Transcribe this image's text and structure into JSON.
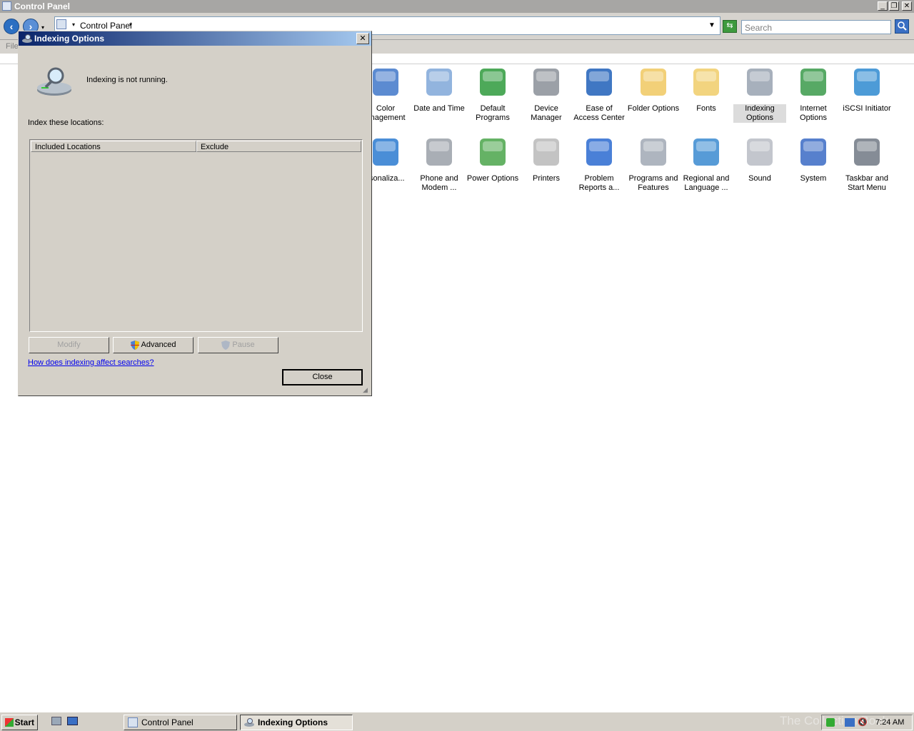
{
  "main_window": {
    "title": "Control Panel",
    "minimize": "_",
    "maximize": "❐",
    "close": "✕"
  },
  "address_bar": {
    "breadcrumb": "Control Panel",
    "search_placeholder": "Search"
  },
  "menu": {
    "file": "File"
  },
  "control_panel_items": [
    {
      "label": "Color\nManagement",
      "visible_text": "Color\nanagement",
      "icon": "color-management-icon"
    },
    {
      "label": "Date and Time",
      "icon": "calendar-clock-icon"
    },
    {
      "label": "Default\nPrograms",
      "icon": "default-programs-icon"
    },
    {
      "label": "Device\nManager",
      "icon": "device-manager-icon"
    },
    {
      "label": "Ease of\nAccess Center",
      "icon": "ease-of-access-icon"
    },
    {
      "label": "Folder Options",
      "icon": "folder-options-icon"
    },
    {
      "label": "Fonts",
      "icon": "fonts-folder-icon"
    },
    {
      "label": "Indexing\nOptions",
      "icon": "indexing-icon",
      "selected": true
    },
    {
      "label": "Internet\nOptions",
      "icon": "internet-options-icon"
    },
    {
      "label": "iSCSI Initiator",
      "icon": "iscsi-icon"
    },
    {
      "label": "rsonaliza...",
      "icon": "personalization-icon"
    },
    {
      "label": "Phone and\nModem ...",
      "icon": "phone-modem-icon"
    },
    {
      "label": "Power Options",
      "icon": "power-options-icon"
    },
    {
      "label": "Printers",
      "icon": "printer-icon"
    },
    {
      "label": "Problem\nReports a...",
      "icon": "problem-reports-icon"
    },
    {
      "label": "Programs and\nFeatures",
      "icon": "programs-features-icon"
    },
    {
      "label": "Regional and\nLanguage ...",
      "icon": "regional-language-icon"
    },
    {
      "label": "Sound",
      "icon": "sound-icon"
    },
    {
      "label": "System",
      "icon": "system-icon"
    },
    {
      "label": "Taskbar and\nStart Menu",
      "icon": "taskbar-start-icon"
    }
  ],
  "dialog": {
    "title": "Indexing Options",
    "close": "✕",
    "status": "Indexing is not running.",
    "index_label": "Index these locations:",
    "columns": [
      "Included Locations",
      "Exclude"
    ],
    "buttons": {
      "modify": "Modify",
      "advanced": "Advanced",
      "pause": "Pause",
      "close": "Close"
    },
    "help_link": "How does indexing affect searches?"
  },
  "taskbar": {
    "start": "Start",
    "tasks": [
      "Control Panel",
      "Indexing Options"
    ],
    "active_task": "Indexing Options",
    "clock": "7:24 AM",
    "watermark": "The Collection Book"
  }
}
